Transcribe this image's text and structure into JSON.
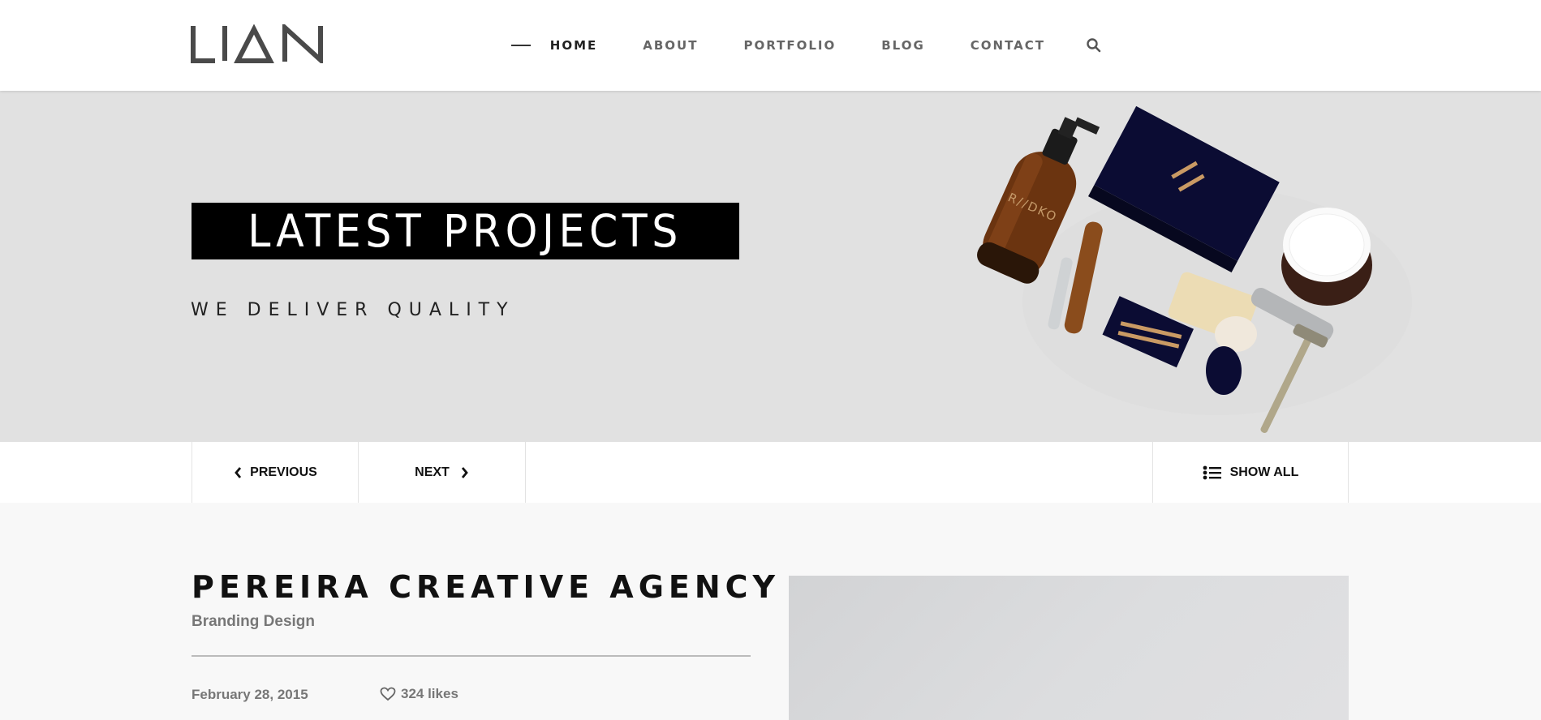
{
  "header": {
    "logo_text": "LIAN",
    "nav": [
      {
        "label": "HOME",
        "active": true
      },
      {
        "label": "ABOUT",
        "active": false
      },
      {
        "label": "PORTFOLIO",
        "active": false
      },
      {
        "label": "BLOG",
        "active": false
      },
      {
        "label": "CONTACT",
        "active": false
      }
    ],
    "search_icon": "search-icon"
  },
  "hero": {
    "title": "LATEST PROJECTS",
    "subtitle": "WE DELIVER QUALITY",
    "image_icon": "product-mockup-image"
  },
  "project_nav": {
    "previous_label": "PREVIOUS",
    "next_label": "NEXT",
    "show_all_label": "SHOW ALL"
  },
  "project": {
    "title": "PEREIRA CREATIVE AGENCY",
    "category": "Branding Design",
    "date": "February 28, 2015",
    "likes": "324 likes"
  },
  "colors": {
    "hero_bg": "#e1e1e1",
    "title_box_bg": "#000000",
    "nav_active": "#222222",
    "nav_inactive": "#666666"
  }
}
